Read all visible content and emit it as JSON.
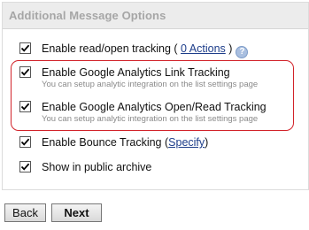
{
  "panel": {
    "title": "Additional Message Options"
  },
  "options": [
    {
      "label": "Enable read/open tracking",
      "paren_open": " ( ",
      "link": "0 Actions",
      "paren_close": " )",
      "checked": true,
      "help_icon": "question-icon"
    },
    {
      "label": "Enable Google Analytics Link Tracking",
      "sub": "You can setup analytic integration on the list settings page",
      "checked": true
    },
    {
      "label": "Enable Google Analytics Open/Read Tracking",
      "sub": "You can setup analytic integration on the list settings page",
      "checked": true
    },
    {
      "label": "Enable Bounce Tracking",
      "paren_open": " (",
      "link": "Specify",
      "paren_close": ")",
      "checked": true
    },
    {
      "label": "Show in public archive",
      "checked": true
    }
  ],
  "buttons": {
    "back": "Back",
    "next": "Next"
  },
  "colors": {
    "highlight_border": "#d2232a",
    "link": "#1d3d8a",
    "header_bg": "#ececec"
  }
}
